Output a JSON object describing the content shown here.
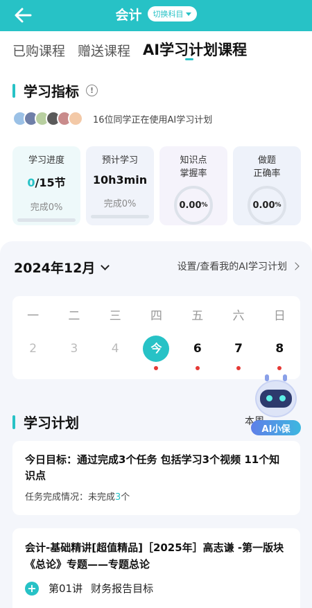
{
  "header": {
    "title": "会计",
    "switch_label": "切换科目"
  },
  "tabs": [
    {
      "label": "已购课程"
    },
    {
      "label": "赠送课程"
    },
    {
      "label": "AI学习计划课程"
    }
  ],
  "indicators": {
    "title": "学习指标",
    "users_text": "16位同学正在使用AI学习计划",
    "cards": [
      {
        "label": "学习进度",
        "value_done": "0",
        "value_total": "/15节",
        "sub": "完成0%",
        "progress": 0
      },
      {
        "label": "预计学习",
        "value": "10h3min",
        "sub": "完成0%",
        "progress": 0
      },
      {
        "label_line1": "知识点",
        "label_line2": "掌握率",
        "ring_value": "0.00",
        "ring_unit": "%"
      },
      {
        "label_line1": "做题",
        "label_line2": "正确率",
        "ring_value": "0.00",
        "ring_unit": "%"
      }
    ]
  },
  "calendar": {
    "month": "2024年12月",
    "plan_link": "设置/查看我的AI学习计划",
    "weekdays": [
      "一",
      "二",
      "三",
      "四",
      "五",
      "六",
      "日"
    ],
    "days": [
      "2",
      "3",
      "4",
      "今",
      "6",
      "7",
      "8"
    ]
  },
  "plan": {
    "title": "学习计划",
    "week_label": "本周",
    "goal_title": "今日目标：通过完成3个任务 包括学习3个视频 11个知识点",
    "status_label": "任务完成情况：未完成",
    "status_count": "3",
    "status_unit": "个",
    "course_title": "会计-基础精讲[超值精品]［2025年］高志谦 -第一版块　《总论》专题——专题总论",
    "lesson_no": "第01讲",
    "lesson_name": "财务报告目标"
  },
  "mascot": {
    "badge": "AI小保"
  },
  "colors": {
    "accent": "#27c2c6",
    "dot": "#e53935"
  }
}
